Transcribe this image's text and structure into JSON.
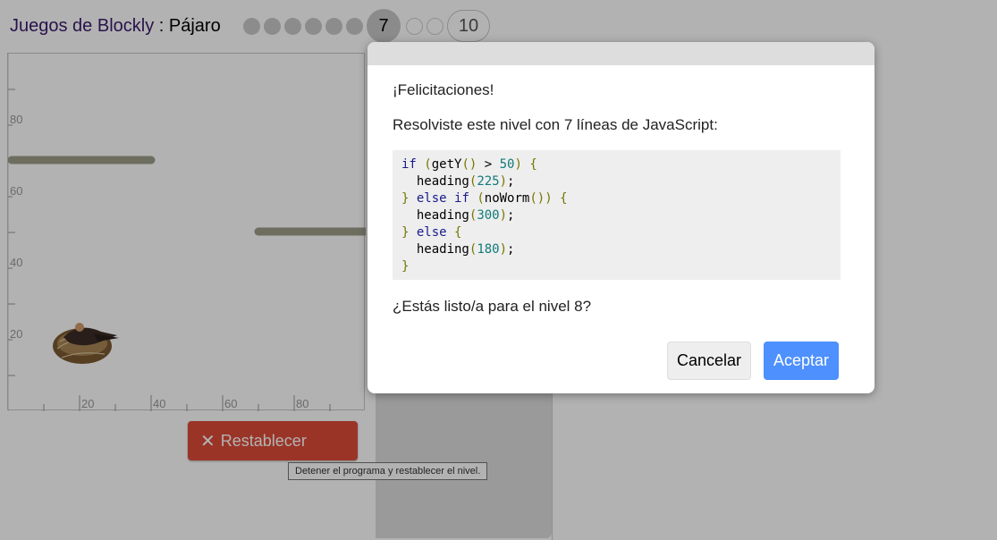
{
  "header": {
    "app_name": "Juegos de Blockly",
    "separator": " : ",
    "game_name": "Pájaro",
    "levels": {
      "completed": [
        "1",
        "2",
        "3",
        "4",
        "5",
        "6"
      ],
      "current": "7",
      "upcoming": [
        "8",
        "9"
      ],
      "last": "10"
    }
  },
  "stage": {
    "y_ticks": [
      "80",
      "60",
      "40",
      "20"
    ],
    "x_ticks": [
      "20",
      "40",
      "60",
      "80"
    ]
  },
  "reset_button": {
    "label": "Restablecer",
    "icon": "close-icon"
  },
  "tooltip": "Detener el programa y restablecer el nivel.",
  "dialog": {
    "congrats": "¡Felicitaciones!",
    "solved_text": "Resolviste este nivel con 7 líneas de JavaScript:",
    "ready_text": "¿Estás listo/a para el nivel 8?",
    "cancel_label": "Cancelar",
    "accept_label": "Aceptar"
  },
  "code": {
    "l1_if": "if",
    "l1_fn": "getY",
    "l1_op": ">",
    "l1_num": "50",
    "l2_fn": "heading",
    "l2_num": "225",
    "l3_else": "else",
    "l3_if": "if",
    "l3_fn": "noWorm",
    "l4_fn": "heading",
    "l4_num": "300",
    "l5_else": "else",
    "l6_fn": "heading",
    "l6_num": "180"
  },
  "colors": {
    "accept": "#4d90fe",
    "reset": "#dd4b39",
    "app_link": "#3b1a6e"
  }
}
